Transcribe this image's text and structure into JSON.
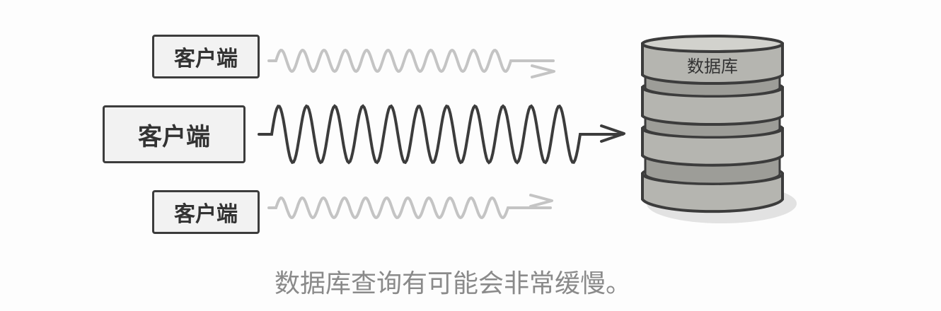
{
  "clients": [
    {
      "label": "客户端",
      "emphasis": "faded"
    },
    {
      "label": "客户端",
      "emphasis": "strong"
    },
    {
      "label": "客户端",
      "emphasis": "faded"
    }
  ],
  "database": {
    "label": "数据库"
  },
  "caption": "数据库查询有可能会非常缓慢。",
  "colors": {
    "stroke_dark": "#3c3c3c",
    "stroke_faded": "#c4c4c4",
    "cylinder_fill": "#b5b5b0",
    "cylinder_shadow": "#e2e2e2",
    "caption": "#8a8a8a"
  }
}
